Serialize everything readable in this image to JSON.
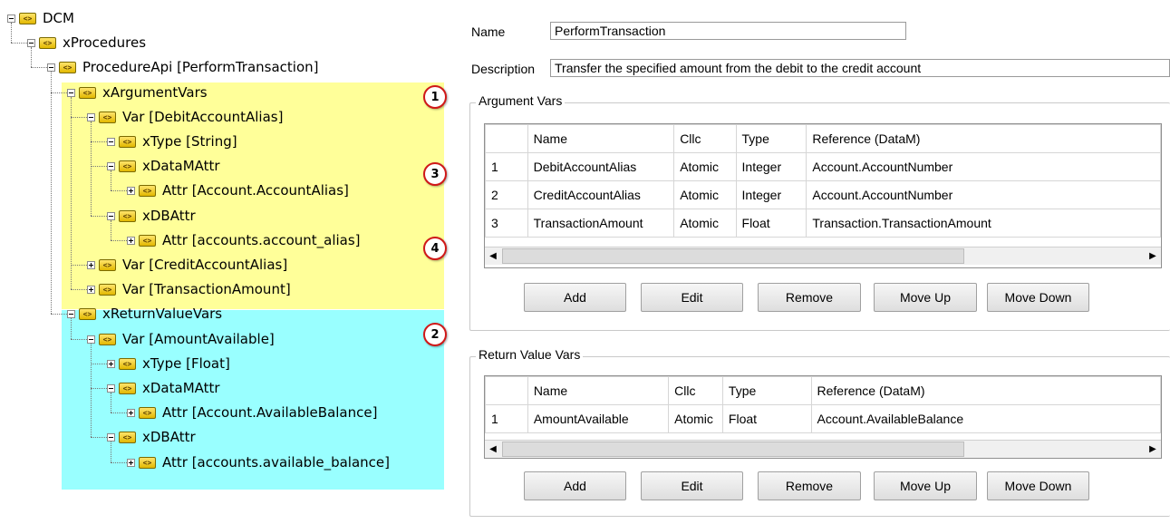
{
  "tree": {
    "nodes": [
      {
        "label": "DCM",
        "expander": "minus"
      },
      {
        "label": "xProcedures",
        "expander": "minus"
      },
      {
        "label": "ProcedureApi [PerformTransaction]",
        "expander": "minus"
      },
      {
        "label": "xArgumentVars",
        "expander": "minus"
      },
      {
        "label": "Var [DebitAccountAlias]",
        "expander": "minus"
      },
      {
        "label": "xType [String]",
        "expander": "minus"
      },
      {
        "label": "xDataMAttr",
        "expander": "minus"
      },
      {
        "label": "Attr [Account.AccountAlias]",
        "expander": "plus"
      },
      {
        "label": "xDBAttr",
        "expander": "minus"
      },
      {
        "label": "Attr [accounts.account_alias]",
        "expander": "plus"
      },
      {
        "label": "Var [CreditAccountAlias]",
        "expander": "plus"
      },
      {
        "label": "Var [TransactionAmount]",
        "expander": "plus"
      },
      {
        "label": "xReturnValueVars",
        "expander": "minus"
      },
      {
        "label": "Var [AmountAvailable]",
        "expander": "minus"
      },
      {
        "label": "xType [Float]",
        "expander": "plus"
      },
      {
        "label": "xDataMAttr",
        "expander": "minus"
      },
      {
        "label": "Attr [Account.AvailableBalance]",
        "expander": "plus"
      },
      {
        "label": "xDBAttr",
        "expander": "minus"
      },
      {
        "label": "Attr [accounts.available_balance]",
        "expander": "plus"
      }
    ],
    "icon_text": "<>",
    "badges": [
      "1",
      "3",
      "4",
      "2"
    ],
    "colors": {
      "argument_highlight": "#ffff99",
      "return_highlight": "#99ffff",
      "badge_border": "#d01818"
    }
  },
  "form": {
    "name_label": "Name",
    "name_value": "PerformTransaction",
    "description_label": "Description",
    "description_value": "Transfer the specified amount from the debit to the credit account",
    "argument_group_title": "Argument Vars",
    "return_group_title": "Return Value Vars",
    "columns": [
      "Name",
      "Cllc",
      "Type",
      "Reference (DataM)"
    ],
    "argument_rows": [
      [
        "1",
        "DebitAccountAlias",
        "Atomic",
        "Integer",
        "Account.AccountNumber"
      ],
      [
        "2",
        "CreditAccountAlias",
        "Atomic",
        "Integer",
        "Account.AccountNumber"
      ],
      [
        "3",
        "TransactionAmount",
        "Atomic",
        "Float",
        "Transaction.TransactionAmount"
      ]
    ],
    "return_rows": [
      [
        "1",
        "AmountAvailable",
        "Atomic",
        "Float",
        "Account.AvailableBalance"
      ]
    ],
    "buttons": [
      "Add",
      "Edit",
      "Remove",
      "Move Up",
      "Move Down"
    ]
  }
}
